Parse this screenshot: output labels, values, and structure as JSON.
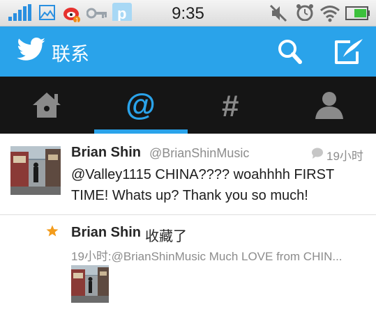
{
  "status_bar": {
    "time": "9:35",
    "left_icons": [
      "signal-icon",
      "gallery-icon",
      "weibo-icon",
      "key-icon",
      "pp-icon"
    ],
    "right_icons": [
      "mute-icon",
      "alarm-icon",
      "wifi-icon",
      "battery-icon"
    ]
  },
  "header": {
    "title": "联系",
    "brand_color": "#2aa3ea"
  },
  "tabs": [
    {
      "icon": "home-icon",
      "active": false
    },
    {
      "icon": "mention-icon",
      "active": true
    },
    {
      "icon": "hashtag-icon",
      "active": false
    },
    {
      "icon": "profile-icon",
      "active": false
    }
  ],
  "timeline": [
    {
      "type": "mention",
      "name": "Brian Shin",
      "handle": "@BrianShinMusic",
      "time": "19小时",
      "text": "@Valley1115 CHINA???? woahhhh FIRST TIME! Whats up? Thank you so much!"
    },
    {
      "type": "favorite",
      "name": "Brian Shin",
      "action": "收藏了",
      "tweet": "19小时:@BrianShinMusic  Much LOVE from CHIN..."
    }
  ]
}
